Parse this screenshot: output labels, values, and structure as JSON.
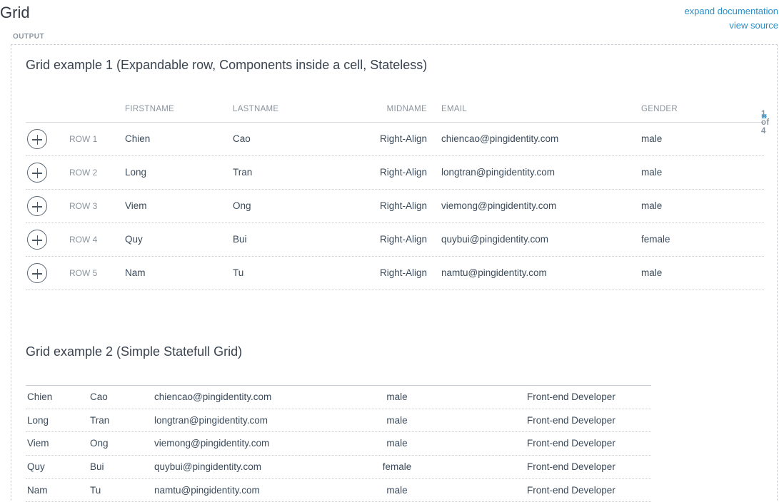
{
  "page": {
    "title": "Grid",
    "links": {
      "expand_documentation": "expand documentation",
      "view_source": "view source"
    },
    "output_label": "OUTPUT"
  },
  "grid1": {
    "title": "Grid example 1 (Expandable row, Components inside a cell, Stateless)",
    "columns": {
      "firstname": "FIRSTNAME",
      "lastname": "LASTNAME",
      "midname": "MIDNAME",
      "email": "EMAIL",
      "gender": "GENDER"
    },
    "pager": {
      "prev_icon": "double-chevron-left-icon",
      "next_icon": "double-chevron-right-icon",
      "info": "1 of 4"
    },
    "rows": [
      {
        "row": "ROW 1",
        "firstname": "Chien",
        "lastname": "Cao",
        "midname": "Right-Align",
        "email": "chiencao@pingidentity.com",
        "gender": "male"
      },
      {
        "row": "ROW 2",
        "firstname": "Long",
        "lastname": "Tran",
        "midname": "Right-Align",
        "email": "longtran@pingidentity.com",
        "gender": "male"
      },
      {
        "row": "ROW 3",
        "firstname": "Viem",
        "lastname": "Ong",
        "midname": "Right-Align",
        "email": "viemong@pingidentity.com",
        "gender": "male"
      },
      {
        "row": "ROW 4",
        "firstname": "Quy",
        "lastname": "Bui",
        "midname": "Right-Align",
        "email": "quybui@pingidentity.com",
        "gender": "female"
      },
      {
        "row": "ROW 5",
        "firstname": "Nam",
        "lastname": "Tu",
        "midname": "Right-Align",
        "email": "namtu@pingidentity.com",
        "gender": "male"
      }
    ]
  },
  "grid2": {
    "title": "Grid example 2 (Simple Statefull Grid)",
    "rows": [
      {
        "firstname": "Chien",
        "lastname": "Cao",
        "email": "chiencao@pingidentity.com",
        "gender": "male",
        "job": "Front-end Developer"
      },
      {
        "firstname": "Long",
        "lastname": "Tran",
        "email": "longtran@pingidentity.com",
        "gender": "male",
        "job": "Front-end Developer"
      },
      {
        "firstname": "Viem",
        "lastname": "Ong",
        "email": "viemong@pingidentity.com",
        "gender": "male",
        "job": "Front-end Developer"
      },
      {
        "firstname": "Quy",
        "lastname": "Bui",
        "email": "quybui@pingidentity.com",
        "gender": "female",
        "job": "Front-end Developer"
      },
      {
        "firstname": "Nam",
        "lastname": "Tu",
        "email": "namtu@pingidentity.com",
        "gender": "male",
        "job": "Front-end Developer"
      }
    ]
  },
  "colors": {
    "link": "#2a8fc9",
    "muted": "#8a949e",
    "text": "#3a4a5a"
  }
}
